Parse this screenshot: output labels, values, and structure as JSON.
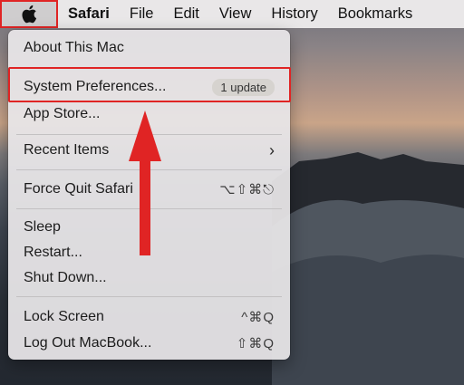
{
  "menubar": {
    "apple_icon": "apple-logo-icon",
    "items": [
      "Safari",
      "File",
      "Edit",
      "View",
      "History",
      "Bookmarks"
    ]
  },
  "apple_menu": {
    "about": "About This Mac",
    "system_prefs": "System Preferences...",
    "update_badge": "1 update",
    "app_store": "App Store...",
    "recent_items": "Recent Items",
    "force_quit": "Force Quit Safari",
    "force_quit_shortcut": "⌥⇧⌘⎋",
    "sleep": "Sleep",
    "restart": "Restart...",
    "shutdown": "Shut Down...",
    "lock_screen": "Lock Screen",
    "lock_shortcut": "^⌘Q",
    "logout": "Log Out MacBook...",
    "logout_shortcut": "⇧⌘Q"
  },
  "colors": {
    "highlight": "#e02424"
  }
}
